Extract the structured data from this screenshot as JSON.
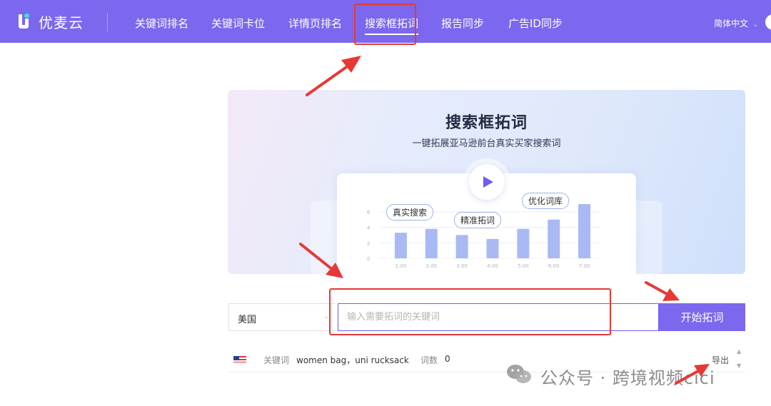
{
  "header": {
    "brand": "优麦云",
    "nav": [
      {
        "label": "关键词排名",
        "active": false
      },
      {
        "label": "关键词卡位",
        "active": false
      },
      {
        "label": "详情页排名",
        "active": false
      },
      {
        "label": "搜索框拓词",
        "active": true
      },
      {
        "label": "报告同步",
        "active": false
      },
      {
        "label": "广告ID同步",
        "active": false
      }
    ],
    "language": "简体中文"
  },
  "banner": {
    "title": "搜索框拓词",
    "subtitle": "一键拓展亚马逊前台真实买家搜索词",
    "tags": [
      "真实搜索",
      "精准拓词",
      "优化词库"
    ]
  },
  "chart_data": {
    "type": "bar",
    "categories": [
      "1:00",
      "2:00",
      "3:00",
      "4:00",
      "5:00",
      "6:00",
      "7:00"
    ],
    "values": [
      3.3,
      3.8,
      3.0,
      2.5,
      3.8,
      5.0,
      7.0
    ],
    "ylim": [
      0,
      8
    ],
    "yticks": [
      "0",
      "2",
      "4",
      "6"
    ],
    "grid": true
  },
  "search": {
    "country": "美国",
    "placeholder": "输入需要拓词的关键词",
    "value": "",
    "button": "开始拓词"
  },
  "result": {
    "keyword_label": "关键词",
    "keyword_value": "women bag，uni rucksack",
    "count_label": "词数",
    "count_value": "0",
    "export": "导出"
  },
  "watermark": {
    "text": "公众号 · 跨境视频cici"
  },
  "colors": {
    "brand": "#7b68ee",
    "annotation": "#e53935",
    "bar": "#a9b9f3"
  },
  "icons": {
    "logo": "youmai-logo-icon",
    "play": "play-icon",
    "flag": "us-flag-icon",
    "wechat": "wechat-icon"
  }
}
